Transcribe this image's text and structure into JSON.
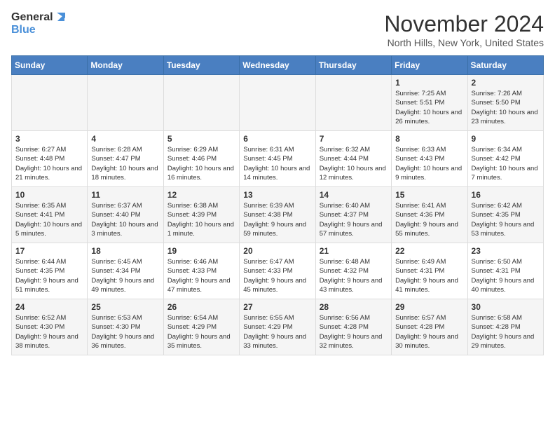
{
  "logo": {
    "text_general": "General",
    "text_blue": "Blue"
  },
  "header": {
    "month": "November 2024",
    "location": "North Hills, New York, United States"
  },
  "weekdays": [
    "Sunday",
    "Monday",
    "Tuesday",
    "Wednesday",
    "Thursday",
    "Friday",
    "Saturday"
  ],
  "weeks": [
    [
      {
        "day": "",
        "info": ""
      },
      {
        "day": "",
        "info": ""
      },
      {
        "day": "",
        "info": ""
      },
      {
        "day": "",
        "info": ""
      },
      {
        "day": "",
        "info": ""
      },
      {
        "day": "1",
        "info": "Sunrise: 7:25 AM\nSunset: 5:51 PM\nDaylight: 10 hours and 26 minutes."
      },
      {
        "day": "2",
        "info": "Sunrise: 7:26 AM\nSunset: 5:50 PM\nDaylight: 10 hours and 23 minutes."
      }
    ],
    [
      {
        "day": "3",
        "info": "Sunrise: 6:27 AM\nSunset: 4:48 PM\nDaylight: 10 hours and 21 minutes."
      },
      {
        "day": "4",
        "info": "Sunrise: 6:28 AM\nSunset: 4:47 PM\nDaylight: 10 hours and 18 minutes."
      },
      {
        "day": "5",
        "info": "Sunrise: 6:29 AM\nSunset: 4:46 PM\nDaylight: 10 hours and 16 minutes."
      },
      {
        "day": "6",
        "info": "Sunrise: 6:31 AM\nSunset: 4:45 PM\nDaylight: 10 hours and 14 minutes."
      },
      {
        "day": "7",
        "info": "Sunrise: 6:32 AM\nSunset: 4:44 PM\nDaylight: 10 hours and 12 minutes."
      },
      {
        "day": "8",
        "info": "Sunrise: 6:33 AM\nSunset: 4:43 PM\nDaylight: 10 hours and 9 minutes."
      },
      {
        "day": "9",
        "info": "Sunrise: 6:34 AM\nSunset: 4:42 PM\nDaylight: 10 hours and 7 minutes."
      }
    ],
    [
      {
        "day": "10",
        "info": "Sunrise: 6:35 AM\nSunset: 4:41 PM\nDaylight: 10 hours and 5 minutes."
      },
      {
        "day": "11",
        "info": "Sunrise: 6:37 AM\nSunset: 4:40 PM\nDaylight: 10 hours and 3 minutes."
      },
      {
        "day": "12",
        "info": "Sunrise: 6:38 AM\nSunset: 4:39 PM\nDaylight: 10 hours and 1 minute."
      },
      {
        "day": "13",
        "info": "Sunrise: 6:39 AM\nSunset: 4:38 PM\nDaylight: 9 hours and 59 minutes."
      },
      {
        "day": "14",
        "info": "Sunrise: 6:40 AM\nSunset: 4:37 PM\nDaylight: 9 hours and 57 minutes."
      },
      {
        "day": "15",
        "info": "Sunrise: 6:41 AM\nSunset: 4:36 PM\nDaylight: 9 hours and 55 minutes."
      },
      {
        "day": "16",
        "info": "Sunrise: 6:42 AM\nSunset: 4:35 PM\nDaylight: 9 hours and 53 minutes."
      }
    ],
    [
      {
        "day": "17",
        "info": "Sunrise: 6:44 AM\nSunset: 4:35 PM\nDaylight: 9 hours and 51 minutes."
      },
      {
        "day": "18",
        "info": "Sunrise: 6:45 AM\nSunset: 4:34 PM\nDaylight: 9 hours and 49 minutes."
      },
      {
        "day": "19",
        "info": "Sunrise: 6:46 AM\nSunset: 4:33 PM\nDaylight: 9 hours and 47 minutes."
      },
      {
        "day": "20",
        "info": "Sunrise: 6:47 AM\nSunset: 4:33 PM\nDaylight: 9 hours and 45 minutes."
      },
      {
        "day": "21",
        "info": "Sunrise: 6:48 AM\nSunset: 4:32 PM\nDaylight: 9 hours and 43 minutes."
      },
      {
        "day": "22",
        "info": "Sunrise: 6:49 AM\nSunset: 4:31 PM\nDaylight: 9 hours and 41 minutes."
      },
      {
        "day": "23",
        "info": "Sunrise: 6:50 AM\nSunset: 4:31 PM\nDaylight: 9 hours and 40 minutes."
      }
    ],
    [
      {
        "day": "24",
        "info": "Sunrise: 6:52 AM\nSunset: 4:30 PM\nDaylight: 9 hours and 38 minutes."
      },
      {
        "day": "25",
        "info": "Sunrise: 6:53 AM\nSunset: 4:30 PM\nDaylight: 9 hours and 36 minutes."
      },
      {
        "day": "26",
        "info": "Sunrise: 6:54 AM\nSunset: 4:29 PM\nDaylight: 9 hours and 35 minutes."
      },
      {
        "day": "27",
        "info": "Sunrise: 6:55 AM\nSunset: 4:29 PM\nDaylight: 9 hours and 33 minutes."
      },
      {
        "day": "28",
        "info": "Sunrise: 6:56 AM\nSunset: 4:28 PM\nDaylight: 9 hours and 32 minutes."
      },
      {
        "day": "29",
        "info": "Sunrise: 6:57 AM\nSunset: 4:28 PM\nDaylight: 9 hours and 30 minutes."
      },
      {
        "day": "30",
        "info": "Sunrise: 6:58 AM\nSunset: 4:28 PM\nDaylight: 9 hours and 29 minutes."
      }
    ]
  ]
}
